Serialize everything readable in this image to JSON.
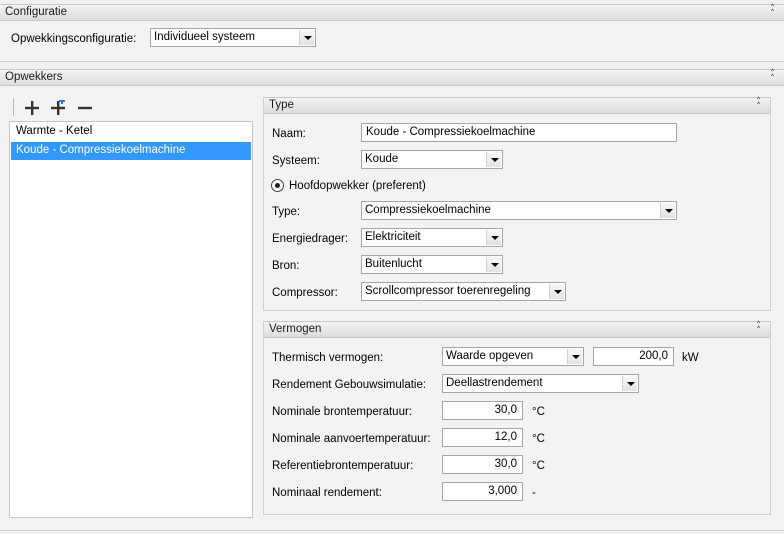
{
  "configuratie": {
    "header": "Configuratie",
    "opwekkings_label": "Opwekkingsconfiguratie:",
    "opwekkings_value": "Individueel systeem"
  },
  "opwekkers": {
    "header": "Opwekkers",
    "toolbar": {
      "add": "add-icon",
      "add_copy": "add-copy-icon",
      "remove": "remove-icon"
    },
    "items": [
      {
        "label": "Warmte - Ketel",
        "selected": false
      },
      {
        "label": "Koude - Compressiekoelmachine",
        "selected": true
      }
    ]
  },
  "type": {
    "header": "Type",
    "naam_label": "Naam:",
    "naam_value": "Koude - Compressiekoelmachine",
    "systeem_label": "Systeem:",
    "systeem_value": "Koude",
    "hoofd_label": "Hoofdopwekker (preferent)",
    "type_label": "Type:",
    "type_value": "Compressiekoelmachine",
    "energiedrager_label": "Energiedrager:",
    "energiedrager_value": "Elektriciteit",
    "bron_label": "Bron:",
    "bron_value": "Buitenlucht",
    "compressor_label": "Compressor:",
    "compressor_value": "Scrollcompressor toerenregeling"
  },
  "vermogen": {
    "header": "Vermogen",
    "thermisch_label": "Thermisch vermogen:",
    "thermisch_select": "Waarde opgeven",
    "thermisch_value": "200,0",
    "thermisch_unit": "kW",
    "rendement_label": "Rendement Gebouwsimulatie:",
    "rendement_value": "Deellastrendement",
    "bron_temp_label": "Nominale brontemperatuur:",
    "bron_temp_value": "30,0",
    "bron_temp_unit": "°C",
    "aanvoer_label": "Nominale aanvoertemperatuur:",
    "aanvoer_value": "12,0",
    "aanvoer_unit": "°C",
    "referentie_label": "Referentiebrontemperatuur:",
    "referentie_value": "30,0",
    "referentie_unit": "°C",
    "nominaal_label": "Nominaal rendement:",
    "nominaal_value": "3,000",
    "nominaal_unit": "-"
  }
}
